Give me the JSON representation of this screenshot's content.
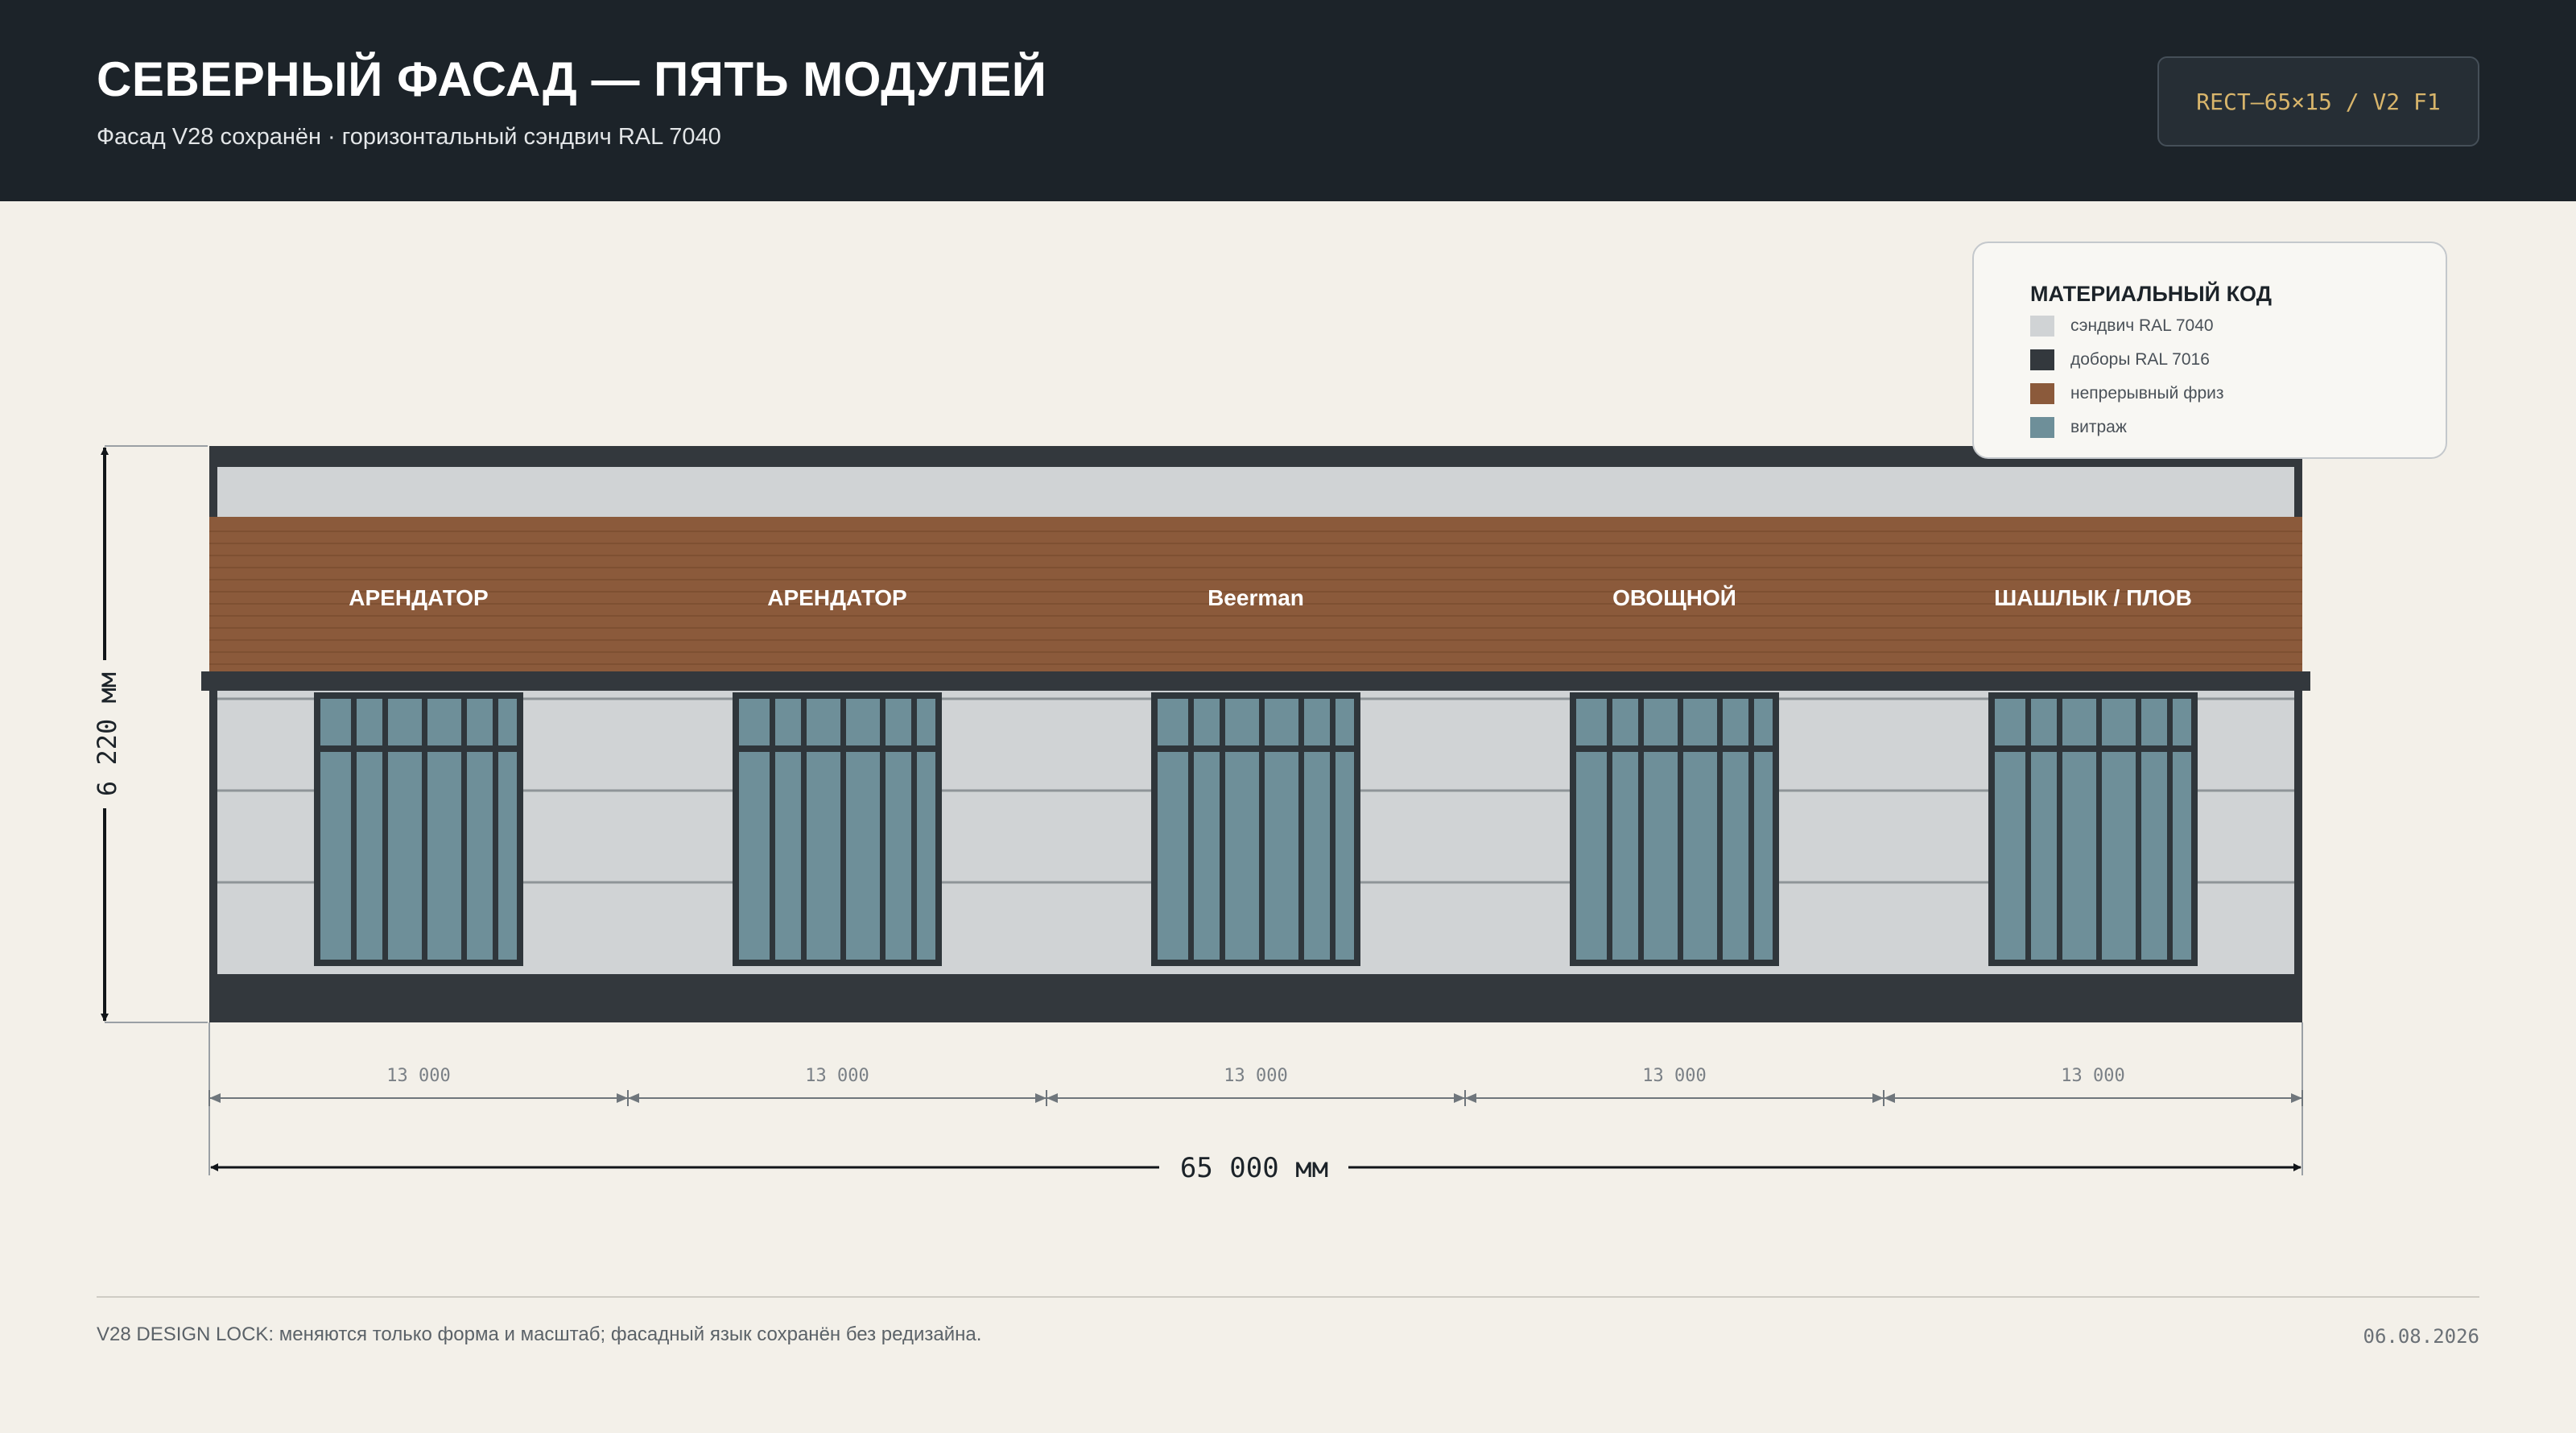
{
  "header": {
    "title": "СЕВЕРНЫЙ ФАСАД — ПЯТЬ МОДУЛЕЙ",
    "subtitle": "Фасад V28 сохранён · горизонтальный сэндвич RAL 7040",
    "code": "RECT–65×15 / V2 F1"
  },
  "legend": {
    "title": "МАТЕРИАЛЬНЫЙ КОД",
    "items": [
      {
        "label": "сэндвич RAL 7040",
        "color": "#d0d3d5"
      },
      {
        "label": "доборы RAL 7016",
        "color": "#33383d"
      },
      {
        "label": "непрерывный фриз",
        "color": "#8b5a3b"
      },
      {
        "label": "витраж",
        "color": "#6e8f99"
      }
    ]
  },
  "facade": {
    "modules": [
      {
        "sign": "АРЕНДАТОР",
        "width_label": "13 000"
      },
      {
        "sign": "АРЕНДАТОР",
        "width_label": "13 000"
      },
      {
        "sign": "Beerman",
        "width_label": "13 000"
      },
      {
        "sign": "ОВОЩНОЙ",
        "width_label": "13 000"
      },
      {
        "sign": "ШАШЛЫК / ПЛОВ",
        "width_label": "13 000"
      }
    ],
    "total_width_label": "65 000 мм",
    "height_label": "6 220 мм",
    "colors": {
      "sandwich": "#d0d3d5",
      "trim": "#33383d",
      "frieze": "#8b5a3b",
      "frieze_line": "#6f4529",
      "glass": "#6e8f99",
      "mullion": "#2f363b"
    }
  },
  "footer": {
    "note": "V28 DESIGN LOCK: меняются только форма и масштаб; фасадный язык сохранён без редизайна.",
    "date": "06.08.2026"
  }
}
